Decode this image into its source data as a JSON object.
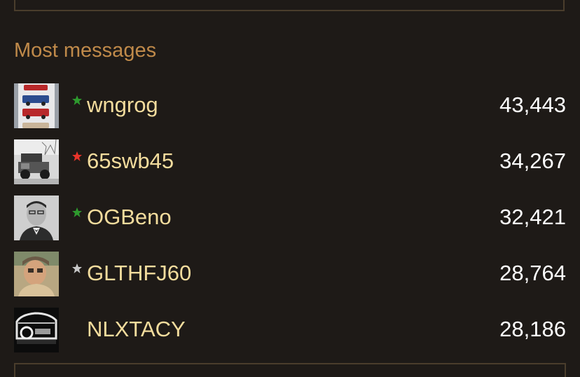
{
  "section": {
    "title": "Most messages"
  },
  "users": [
    {
      "name": "wngrog",
      "count": "43,443",
      "star": "green",
      "avatar": "trucks-avatar"
    },
    {
      "name": "65swb45",
      "count": "34,267",
      "star": "red",
      "avatar": "landcruiser-avatar"
    },
    {
      "name": "OGBeno",
      "count": "32,421",
      "star": "green",
      "avatar": "portrait-avatar"
    },
    {
      "name": "GLTHFJ60",
      "count": "28,764",
      "star": "silver",
      "avatar": "face-avatar"
    },
    {
      "name": "NLXTACY",
      "count": "28,186",
      "star": "none",
      "avatar": "dark-truck-avatar"
    }
  ],
  "colors": {
    "background": "#1e1a17",
    "title": "#c08a4a",
    "username": "#f3dc9d",
    "count": "#ffffff",
    "star_green": "#2e9a2e",
    "star_red": "#e8342a",
    "star_silver": "#c8c8c8",
    "border": "#4a3d2c"
  }
}
